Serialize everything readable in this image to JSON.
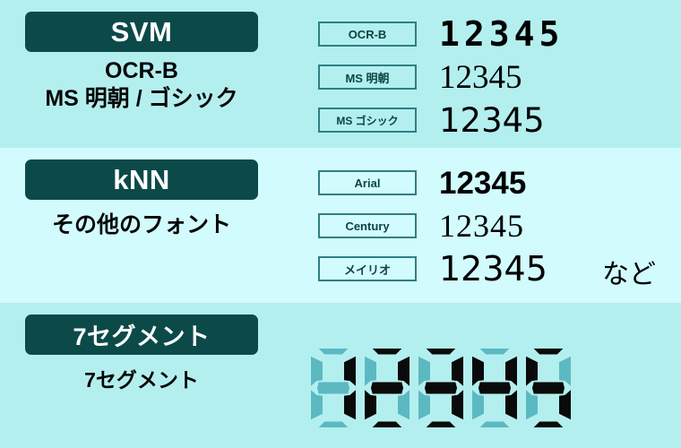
{
  "palette": {
    "band_dark": "#b4efef",
    "band_light": "#d2fbfd",
    "pill_bg": "#0c4a4a",
    "pill_text": "#ffffff",
    "tag_border": "#2e7f83",
    "tag_text": "#0c4444",
    "sample_text": "#000000",
    "seg_on": "#0a0a0a",
    "seg_off": "#5cb9c2"
  },
  "sections": [
    {
      "id": "svm",
      "pill_label": "SVM",
      "subtitle": "OCR-B\nMS 明朝 / ゴシック",
      "subtitle_line1": "OCR-B",
      "subtitle_line2": "MS 明朝 / ゴシック",
      "rows": [
        {
          "tag": "OCR-B",
          "sample": "12345"
        },
        {
          "tag": "MS 明朝",
          "sample": "12345"
        },
        {
          "tag": "MS ゴシック",
          "sample": "12345"
        }
      ]
    },
    {
      "id": "knn",
      "pill_label": "kNN",
      "subtitle": "その他のフォント",
      "subtitle_line1": "その他のフォント",
      "rows": [
        {
          "tag": "Arial",
          "sample": "12345"
        },
        {
          "tag": "Century",
          "sample": "12345"
        },
        {
          "tag": "メイリオ",
          "sample": "12345"
        }
      ],
      "trailing_note": "など"
    },
    {
      "id": "seven-segment",
      "pill_label": "7セグメント",
      "subtitle": "7セグメント",
      "subtitle_line1": "7セグメント",
      "display_value": "12345",
      "digits": [
        {
          "char": "1",
          "segments": {
            "a": false,
            "b": true,
            "c": true,
            "d": false,
            "e": false,
            "f": false,
            "g": false
          }
        },
        {
          "char": "2",
          "segments": {
            "a": true,
            "b": true,
            "c": false,
            "d": true,
            "e": true,
            "f": false,
            "g": true
          }
        },
        {
          "char": "3",
          "segments": {
            "a": true,
            "b": true,
            "c": true,
            "d": true,
            "e": false,
            "f": false,
            "g": true
          }
        },
        {
          "char": "4",
          "segments": {
            "a": false,
            "b": true,
            "c": true,
            "d": false,
            "e": false,
            "f": true,
            "g": true
          }
        },
        {
          "char": "5",
          "segments": {
            "a": true,
            "b": false,
            "c": true,
            "d": true,
            "e": false,
            "f": true,
            "g": true
          }
        }
      ]
    }
  ]
}
